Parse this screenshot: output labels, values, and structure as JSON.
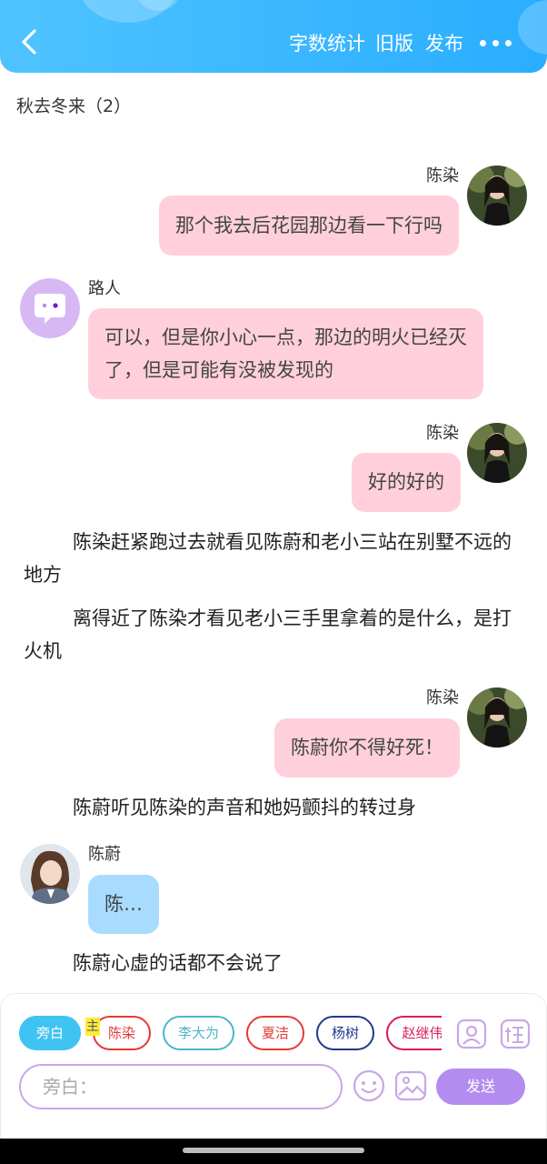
{
  "header": {
    "word_count_label": "字数统计",
    "old_version_label": "旧版",
    "publish_label": "发布",
    "background_color": "#38b6ff"
  },
  "chapter_title": "秋去冬来（2）",
  "messages": [
    {
      "speaker": "陈染",
      "side": "right",
      "text": "那个我去后花园那边看一下行吗",
      "bubble_color": "#ffd0dc"
    },
    {
      "speaker": "路人",
      "side": "left",
      "text": "可以，但是你小心一点，那边的明火已经灭了，但是可能有没被发现的",
      "bubble_color": "#ffd0dc"
    },
    {
      "speaker": "陈染",
      "side": "right",
      "text": "好的好的",
      "bubble_color": "#ffd0dc"
    },
    {
      "speaker": "陈染",
      "side": "right",
      "text": "陈蔚你不得好死！",
      "bubble_color": "#ffd0dc"
    },
    {
      "speaker": "陈蔚",
      "side": "left",
      "text": "陈…",
      "bubble_color": "#a8dcff"
    }
  ],
  "narrations": [
    "陈染赶紧跑过去就看见陈蔚和老小三站在别墅不远的地方",
    "离得近了陈染才看见老小三手里拿着的是什么，是打火机",
    "陈蔚听见陈染的声音和她妈颤抖的转过身",
    "陈蔚心虚的话都不会说了"
  ],
  "characters": [
    {
      "label": "旁白",
      "selected": true,
      "color": "#3fc3f3"
    },
    {
      "label": "陈染",
      "selected": false,
      "color": "#e53935"
    },
    {
      "label": "李大为",
      "selected": false,
      "color": "#4db6c9"
    },
    {
      "label": "夏洁",
      "selected": false,
      "color": "#e53935"
    },
    {
      "label": "杨树",
      "selected": false,
      "color": "#1e3a8a"
    },
    {
      "label": "赵继伟",
      "selected": false,
      "color": "#d81b60"
    }
  ],
  "main_tag": "主",
  "composer": {
    "placeholder": "旁白：",
    "send_label": "发送",
    "accent_color": "#b48cf0"
  },
  "icons": [
    "back-arrow-icon",
    "more-icon",
    "contact-icon",
    "tag-icon",
    "emoji-icon",
    "image-icon"
  ]
}
